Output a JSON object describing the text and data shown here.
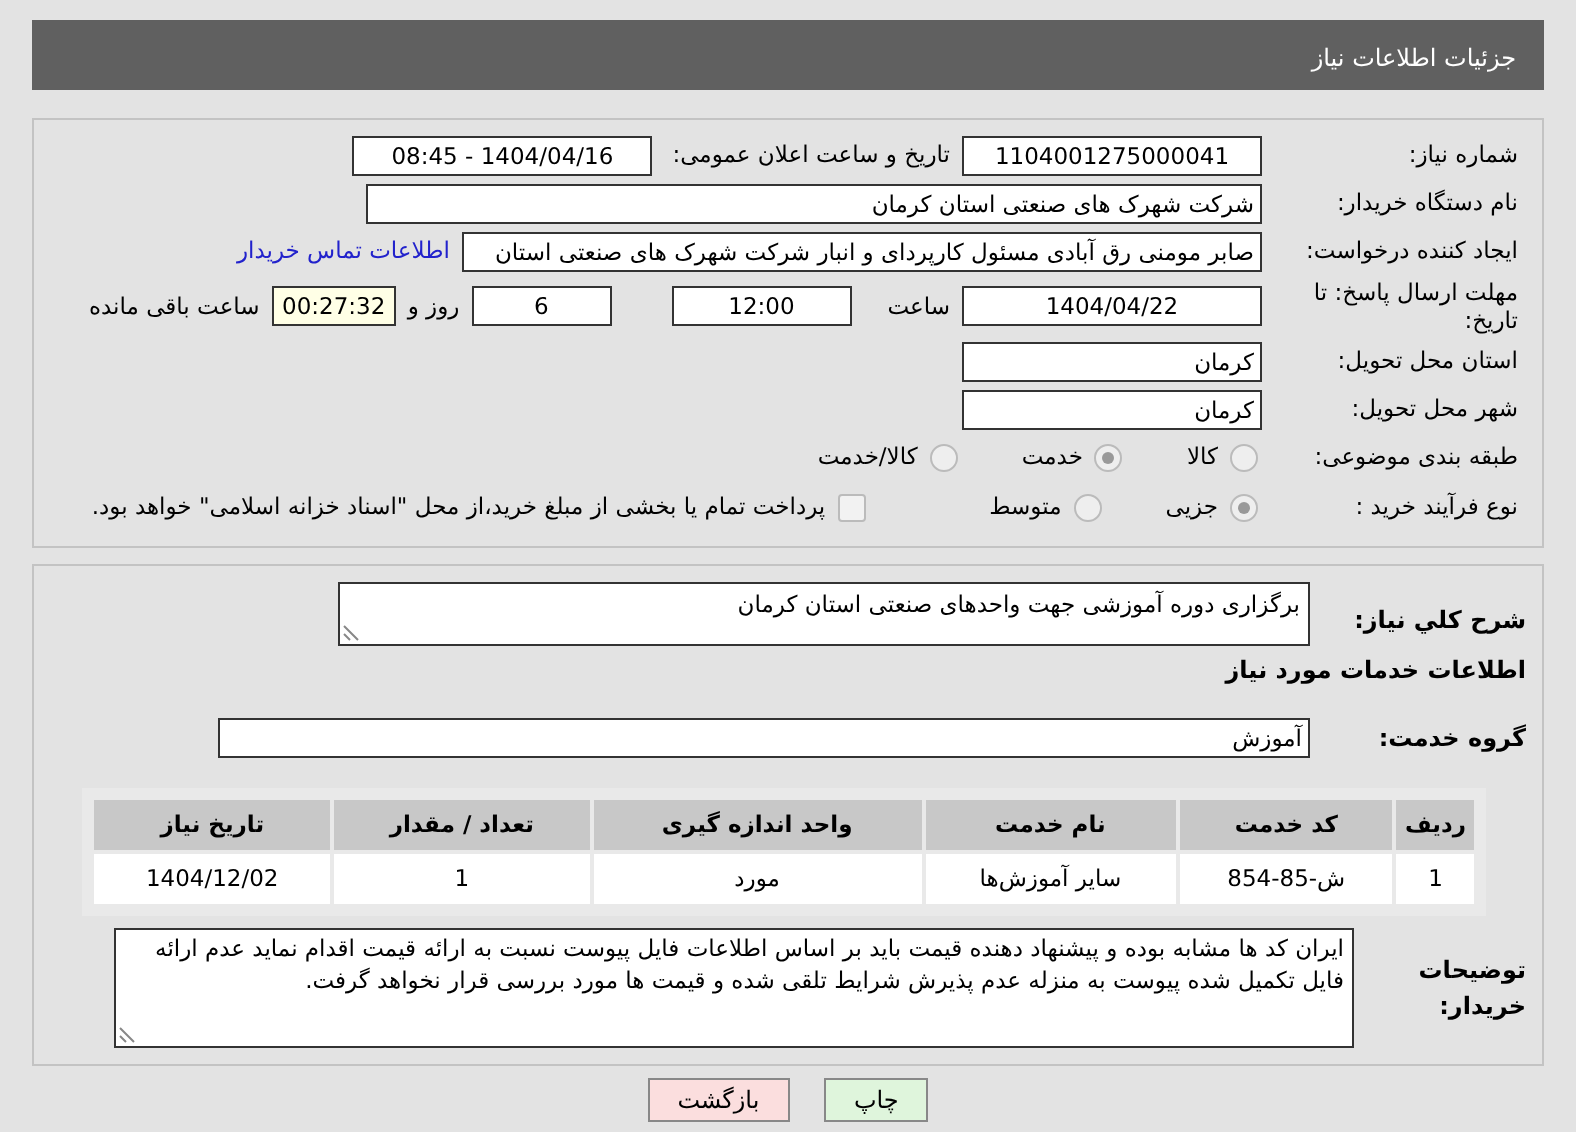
{
  "header": {
    "title": "جزئیات اطلاعات نیاز"
  },
  "need_number": {
    "label": "شماره نیاز:",
    "value": "1104001275000041"
  },
  "announce": {
    "label": "تاریخ و ساعت اعلان عمومی:",
    "value": "1404/04/16 - 08:45"
  },
  "buyer_org": {
    "label": "نام دستگاه خریدار:",
    "value": "شرکت شهرک های صنعتی استان کرمان"
  },
  "requester": {
    "label": "ایجاد کننده درخواست:",
    "value": "صابر مومنی رق آبادی مسئول کارپردای و انبار شرکت شهرک های صنعتی استان",
    "contact_link": "اطلاعات تماس خریدار"
  },
  "deadline": {
    "label": "مهلت ارسال پاسخ: تا تاریخ:",
    "date": "1404/04/22",
    "time_label": "ساعت",
    "time": "12:00",
    "days": "6",
    "days_label": "روز و",
    "remaining": "00:27:32",
    "remaining_label": "ساعت باقی مانده"
  },
  "province": {
    "label": "استان محل تحویل:",
    "value": "کرمان"
  },
  "city": {
    "label": "شهر محل تحویل:",
    "value": "کرمان"
  },
  "category": {
    "label": "طبقه بندی موضوعی:",
    "options": [
      {
        "label": "کالا",
        "selected": false
      },
      {
        "label": "خدمت",
        "selected": true
      },
      {
        "label": "کالا/خدمت",
        "selected": false
      }
    ]
  },
  "purchase_type": {
    "label": "نوع فرآیند خرید :",
    "options": [
      {
        "label": "جزیی",
        "selected": true
      },
      {
        "label": "متوسط",
        "selected": false
      }
    ],
    "payment": {
      "checked": false,
      "label": "پرداخت تمام یا بخشی از مبلغ خرید،از محل \"اسناد خزانه اسلامی\" خواهد بود."
    }
  },
  "description": {
    "label": "شرح کلي نیاز:",
    "value": "برگزاری دوره آموزشی جهت واحدهای صنعتی استان کرمان"
  },
  "services_heading": "اطلاعات خدمات مورد نیاز",
  "service_group": {
    "label": "گروه خدمت:",
    "value": "آموزش"
  },
  "table": {
    "columns": [
      "ردیف",
      "کد خدمت",
      "نام خدمت",
      "واحد اندازه گیری",
      "تعداد / مقدار",
      "تاریخ نیاز"
    ],
    "rows": [
      [
        "1",
        "ش-85-854",
        "سایر آموزش‌ها",
        "مورد",
        "1",
        "1404/12/02"
      ]
    ]
  },
  "buyer_notes": {
    "label": "توضیحات خریدار:",
    "value": "ایران کد ها مشابه بوده و پیشنهاد دهنده قیمت باید بر اساس اطلاعات فایل پیوست نسبت به ارائه قیمت اقدام نماید عدم ارائه فایل تکمیل شده پیوست به منزله عدم پذیرش شرایط تلقی شده و قیمت ها مورد بررسی قرار نخواهد گرفت."
  },
  "buttons": [
    {
      "label": "چاپ",
      "kind": "print"
    },
    {
      "label": "بازگشت",
      "kind": "back"
    }
  ]
}
